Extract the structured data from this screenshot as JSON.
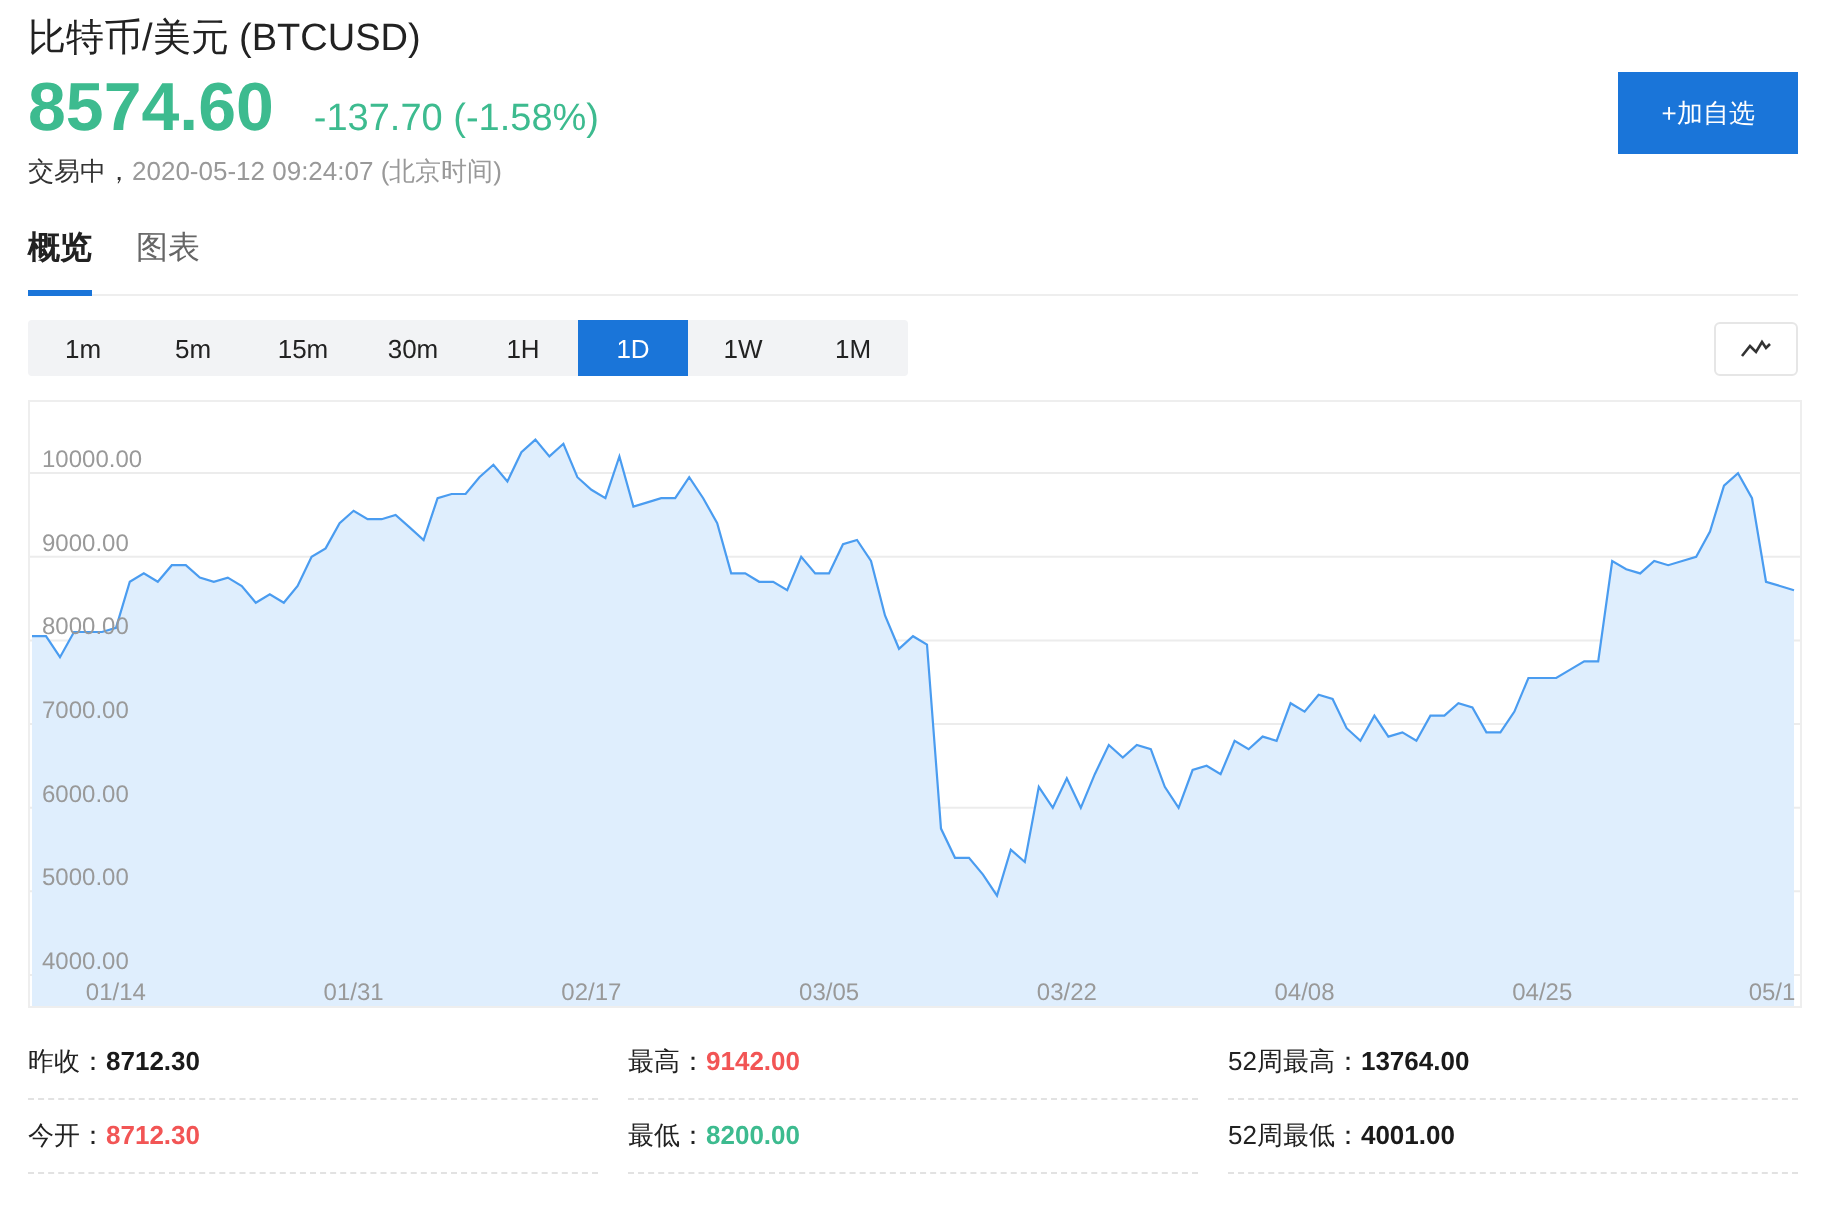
{
  "header": {
    "title": "比特币/美元 (BTCUSD)",
    "price": "8574.60",
    "change": "-137.70 (-1.58%)",
    "status": "交易中，",
    "timestamp": "2020-05-12 09:24:07 (北京时间)",
    "watch_button": "+加自选"
  },
  "tabs": [
    {
      "label": "概览",
      "selected": true
    },
    {
      "label": "图表",
      "selected": false
    }
  ],
  "intervals": [
    {
      "label": "1m",
      "selected": false
    },
    {
      "label": "5m",
      "selected": false
    },
    {
      "label": "15m",
      "selected": false
    },
    {
      "label": "30m",
      "selected": false
    },
    {
      "label": "1H",
      "selected": false
    },
    {
      "label": "1D",
      "selected": true
    },
    {
      "label": "1W",
      "selected": false
    },
    {
      "label": "1M",
      "selected": false
    }
  ],
  "chart_data": {
    "type": "area",
    "grid": true,
    "ylim": [
      4000,
      10850
    ],
    "yticks": [
      {
        "value": 4000,
        "label": "4000.00"
      },
      {
        "value": 5000,
        "label": "5000.00"
      },
      {
        "value": 6000,
        "label": "6000.00"
      },
      {
        "value": 7000,
        "label": "7000.00"
      },
      {
        "value": 8000,
        "label": "8000.00"
      },
      {
        "value": 9000,
        "label": "9000.00"
      },
      {
        "value": 10000,
        "label": "10000.00"
      }
    ],
    "categories": [
      null,
      null,
      null,
      null,
      null,
      null,
      "01/14",
      null,
      null,
      null,
      null,
      null,
      null,
      null,
      null,
      null,
      null,
      null,
      null,
      null,
      null,
      null,
      null,
      "01/31",
      null,
      null,
      null,
      null,
      null,
      null,
      null,
      null,
      null,
      null,
      null,
      null,
      null,
      null,
      null,
      null,
      "02/17",
      null,
      null,
      null,
      null,
      null,
      null,
      null,
      null,
      null,
      null,
      null,
      null,
      null,
      null,
      null,
      null,
      "03/05",
      null,
      null,
      null,
      null,
      null,
      null,
      null,
      null,
      null,
      null,
      null,
      null,
      null,
      null,
      null,
      null,
      "03/22",
      null,
      null,
      null,
      null,
      null,
      null,
      null,
      null,
      null,
      null,
      null,
      null,
      null,
      null,
      null,
      null,
      "04/08",
      null,
      null,
      null,
      null,
      null,
      null,
      null,
      null,
      null,
      null,
      null,
      null,
      null,
      null,
      null,
      null,
      "04/25",
      null,
      null,
      null,
      null,
      null,
      null,
      null,
      null,
      null,
      null,
      null,
      null,
      null,
      null,
      null,
      null,
      "05/1",
      null
    ],
    "series": [
      {
        "color": "#4a9cf0",
        "values": [
          8050,
          8050,
          7800,
          8100,
          8100,
          8100,
          8150,
          8700,
          8800,
          8700,
          8900,
          8900,
          8750,
          8700,
          8750,
          8650,
          8450,
          8550,
          8450,
          8650,
          9000,
          9100,
          9400,
          9550,
          9450,
          9450,
          9500,
          9350,
          9200,
          9700,
          9750,
          9750,
          9950,
          10100,
          9900,
          10250,
          10400,
          10200,
          10350,
          9950,
          9800,
          9700,
          10200,
          9600,
          9650,
          9700,
          9700,
          9950,
          9700,
          9400,
          8800,
          8800,
          8700,
          8700,
          8600,
          9000,
          8800,
          8800,
          9150,
          9200,
          8950,
          8300,
          7900,
          8050,
          7950,
          5750,
          5400,
          5400,
          5200,
          4950,
          5500,
          5350,
          6250,
          6000,
          6350,
          6000,
          6400,
          6750,
          6600,
          6750,
          6700,
          6250,
          6000,
          6450,
          6500,
          6400,
          6800,
          6700,
          6850,
          6800,
          7250,
          7150,
          7350,
          7300,
          6950,
          6800,
          7100,
          6850,
          6900,
          6800,
          7100,
          7100,
          7250,
          7200,
          6900,
          6900,
          7150,
          7550,
          7550,
          7550,
          7650,
          7750,
          7750,
          8950,
          8850,
          8800,
          8950,
          8900,
          8950,
          9000,
          9300,
          9850,
          10000,
          9700,
          8700,
          8650,
          8600
        ]
      }
    ]
  },
  "stats": [
    {
      "label": "昨收：",
      "value": "8712.30",
      "color": "#1a1a1a"
    },
    {
      "label": "最高：",
      "value": "9142.00",
      "color": "#f25555"
    },
    {
      "label": "52周最高：",
      "value": "13764.00",
      "color": "#1a1a1a"
    },
    {
      "label": "今开：",
      "value": "8712.30",
      "color": "#f25555"
    },
    {
      "label": "最低：",
      "value": "8200.00",
      "color": "#3dbb8f"
    },
    {
      "label": "52周最低：",
      "value": "4001.00",
      "color": "#1a1a1a"
    }
  ]
}
